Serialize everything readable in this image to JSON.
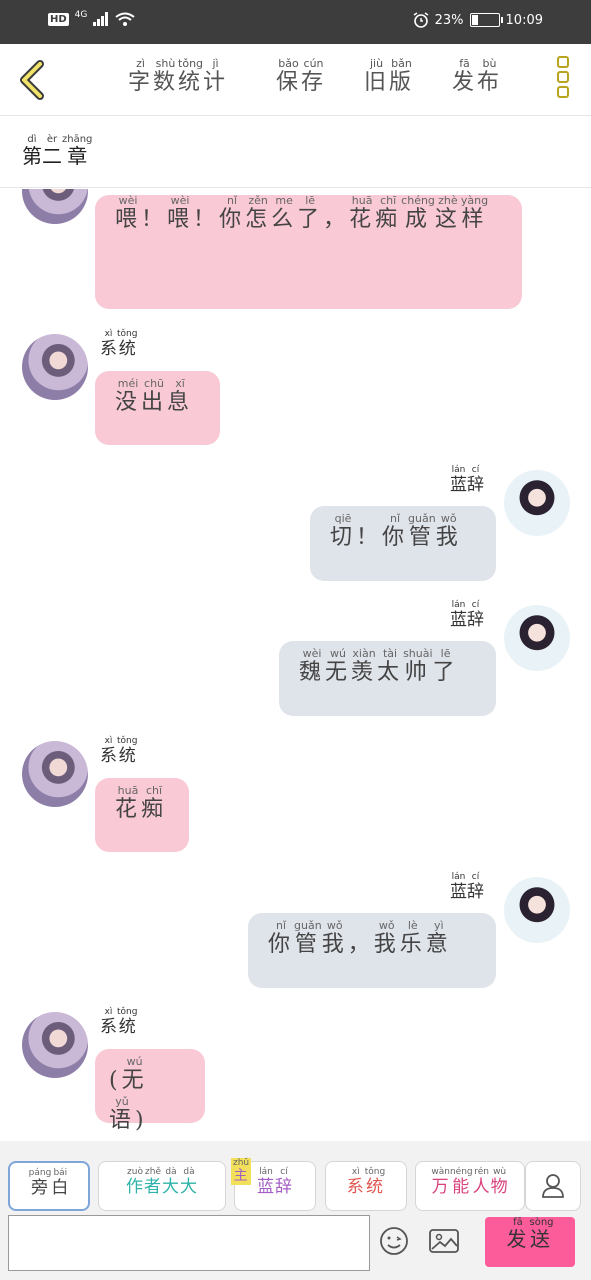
{
  "status_bar": {
    "network": "HD",
    "signal_gen": "4G",
    "battery_percent": "23%",
    "battery_level": 0.23,
    "time": "10:09"
  },
  "toolbar": {
    "word_count": {
      "label": [
        "字",
        "数",
        "统",
        "计"
      ],
      "pinyin": [
        "zì",
        "shù",
        "tǒng",
        "jì"
      ]
    },
    "save": {
      "label": [
        "保",
        "存"
      ],
      "pinyin": [
        "bǎo",
        "cún"
      ]
    },
    "old_version": {
      "label": [
        "旧",
        "版"
      ],
      "pinyin": [
        "jiù",
        "bǎn"
      ]
    },
    "publish": {
      "label": [
        "发",
        "布"
      ],
      "pinyin": [
        "fā",
        "bù"
      ]
    }
  },
  "chapter": {
    "label": [
      "第",
      "二",
      "章"
    ],
    "pinyin": [
      "dì",
      "èr",
      "zhāng"
    ]
  },
  "messages": [
    {
      "side": "left",
      "avatar": "system-avatar",
      "text": [
        [
          "喂",
          "wèi"
        ],
        [
          "！",
          ""
        ],
        [
          "喂",
          "wèi"
        ],
        [
          "！",
          ""
        ],
        [
          "你",
          "nǐ"
        ],
        [
          "怎",
          "zěn"
        ],
        [
          "么",
          "me"
        ],
        [
          "了",
          "lē"
        ],
        [
          "，",
          ""
        ],
        [
          "花",
          "huā"
        ],
        [
          "痴",
          "chī"
        ],
        [
          "成",
          "chéng"
        ],
        [
          "这",
          "zhè"
        ],
        [
          "样",
          "yàng"
        ]
      ]
    },
    {
      "side": "left",
      "sender": [
        [
          "系",
          "xì"
        ],
        [
          "统",
          "tǒng"
        ]
      ],
      "avatar": "system-avatar",
      "text": [
        [
          "没",
          "méi"
        ],
        [
          "出",
          "chū"
        ],
        [
          "息",
          "xī"
        ]
      ]
    },
    {
      "side": "right",
      "sender": [
        [
          "蓝",
          "lán"
        ],
        [
          "辞",
          "cí"
        ]
      ],
      "avatar": "lanci-avatar",
      "text": [
        [
          "切",
          "qiē"
        ],
        [
          "！",
          ""
        ],
        [
          "你",
          "nǐ"
        ],
        [
          "管",
          "guǎn"
        ],
        [
          "我",
          "wǒ"
        ]
      ]
    },
    {
      "side": "right",
      "sender": [
        [
          "蓝",
          "lán"
        ],
        [
          "辞",
          "cí"
        ]
      ],
      "avatar": "lanci-avatar",
      "text": [
        [
          "魏",
          "wèi"
        ],
        [
          "无",
          "wú"
        ],
        [
          "羡",
          "xiàn"
        ],
        [
          "太",
          "tài"
        ],
        [
          "帅",
          "shuài"
        ],
        [
          "了",
          "lē"
        ]
      ]
    },
    {
      "side": "left",
      "sender": [
        [
          "系",
          "xì"
        ],
        [
          "统",
          "tǒng"
        ]
      ],
      "avatar": "system-avatar",
      "text": [
        [
          "花",
          "huā"
        ],
        [
          "痴",
          "chī"
        ]
      ]
    },
    {
      "side": "right",
      "sender": [
        [
          "蓝",
          "lán"
        ],
        [
          "辞",
          "cí"
        ]
      ],
      "avatar": "lanci-avatar",
      "text": [
        [
          "你",
          "nǐ"
        ],
        [
          "管",
          "guǎn"
        ],
        [
          "我",
          "wǒ"
        ],
        [
          "，",
          ""
        ],
        [
          "我",
          "wǒ"
        ],
        [
          "乐",
          "lè"
        ],
        [
          "意",
          "yì"
        ]
      ]
    },
    {
      "side": "left",
      "sender": [
        [
          "系",
          "xì"
        ],
        [
          "统",
          "tǒng"
        ]
      ],
      "avatar": "system-avatar",
      "text": [
        [
          "(",
          ""
        ],
        [
          "无",
          "wú"
        ],
        [
          "语",
          "yǔ"
        ],
        [
          ")",
          ""
        ]
      ]
    }
  ],
  "roles": [
    {
      "name": [
        [
          "旁",
          "páng"
        ],
        [
          "白",
          "bái"
        ]
      ],
      "color": "#444444",
      "active": true
    },
    {
      "name": [
        [
          "作",
          "zuò"
        ],
        [
          "者",
          "zhě"
        ],
        [
          "大",
          "dà"
        ],
        [
          "大",
          "dà"
        ]
      ],
      "color": "#2fb3a8",
      "active": false
    },
    {
      "name": [
        [
          "蓝",
          "lán"
        ],
        [
          "辞",
          "cí"
        ]
      ],
      "color": "#a45fc4",
      "badge": [
        [
          "主",
          "zhǔ"
        ]
      ],
      "active": false
    },
    {
      "name": [
        [
          "系",
          "xì"
        ],
        [
          "统",
          "tǒng"
        ]
      ],
      "color": "#e0574f",
      "active": false
    },
    {
      "name": [
        [
          "万",
          "wàn"
        ],
        [
          "能",
          "néng"
        ],
        [
          "人",
          "rén"
        ],
        [
          "物",
          "wù"
        ]
      ],
      "color": "#d9447f",
      "active": false
    }
  ],
  "input": {
    "value": "",
    "placeholder": ""
  },
  "send": [
    [
      "发",
      "fā"
    ],
    [
      "送",
      "sòng"
    ]
  ],
  "colors": {
    "pink_bubble": "#f9c9d6",
    "grey_bubble": "#dfe3ea",
    "send_button": "#fd5c9b",
    "toolbar_accent": "#b8a41e"
  }
}
